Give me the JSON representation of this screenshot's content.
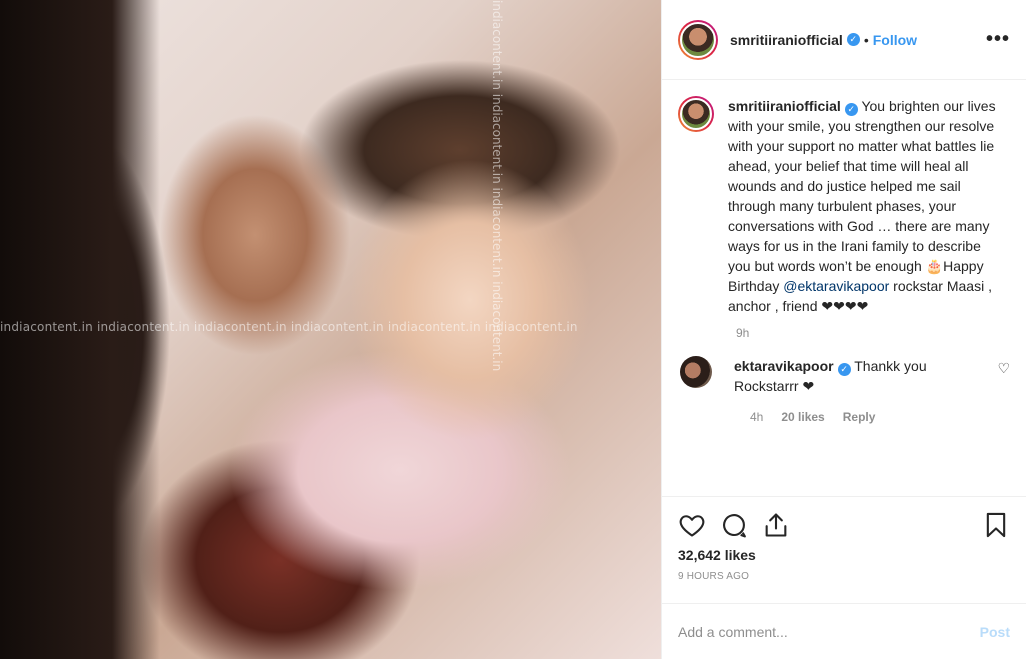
{
  "post": {
    "username": "smritiiraniofficial",
    "follow_label": "Follow",
    "dot": "•",
    "more": "•••"
  },
  "photo": {
    "watermark_text": "indiacontent.in   indiacontent.in   indiacontent.in   indiacontent.in   indiacontent.in   indiacontent.in",
    "watermark_vertical": "indiacontent.in indiacontent.in indiacontent.in indiacontent.in"
  },
  "caption": {
    "username": "smritiiraniofficial",
    "text": "You brighten our lives with your smile, you strengthen our resolve with your support no matter what battles lie ahead, your belief that time will heal all wounds and do justice helped me sail through many turbulent phases, your conversations with God … there are many ways for us in the Irani family to describe you but words won’t be enough 🎂Happy Birthday",
    "mention": "@ektaravikapoor",
    "tail": " rockstar Maasi , anchor , friend ❤❤❤❤",
    "time": "9h"
  },
  "reply": {
    "username": "ektaravikapoor",
    "text": "Thankk you Rockstarrr ❤",
    "time": "4h",
    "likes": "20 likes",
    "reply_label": "Reply"
  },
  "stats": {
    "likes": "32,642 likes",
    "time_ago": "9 HOURS AGO"
  },
  "composer": {
    "placeholder": "Add a comment...",
    "post_label": "Post"
  },
  "colors": {
    "accent": "#3897f0",
    "post_disabled": "#b9dcfa"
  },
  "icons": [
    "heart-icon",
    "comment-icon",
    "share-icon",
    "bookmark-icon"
  ]
}
